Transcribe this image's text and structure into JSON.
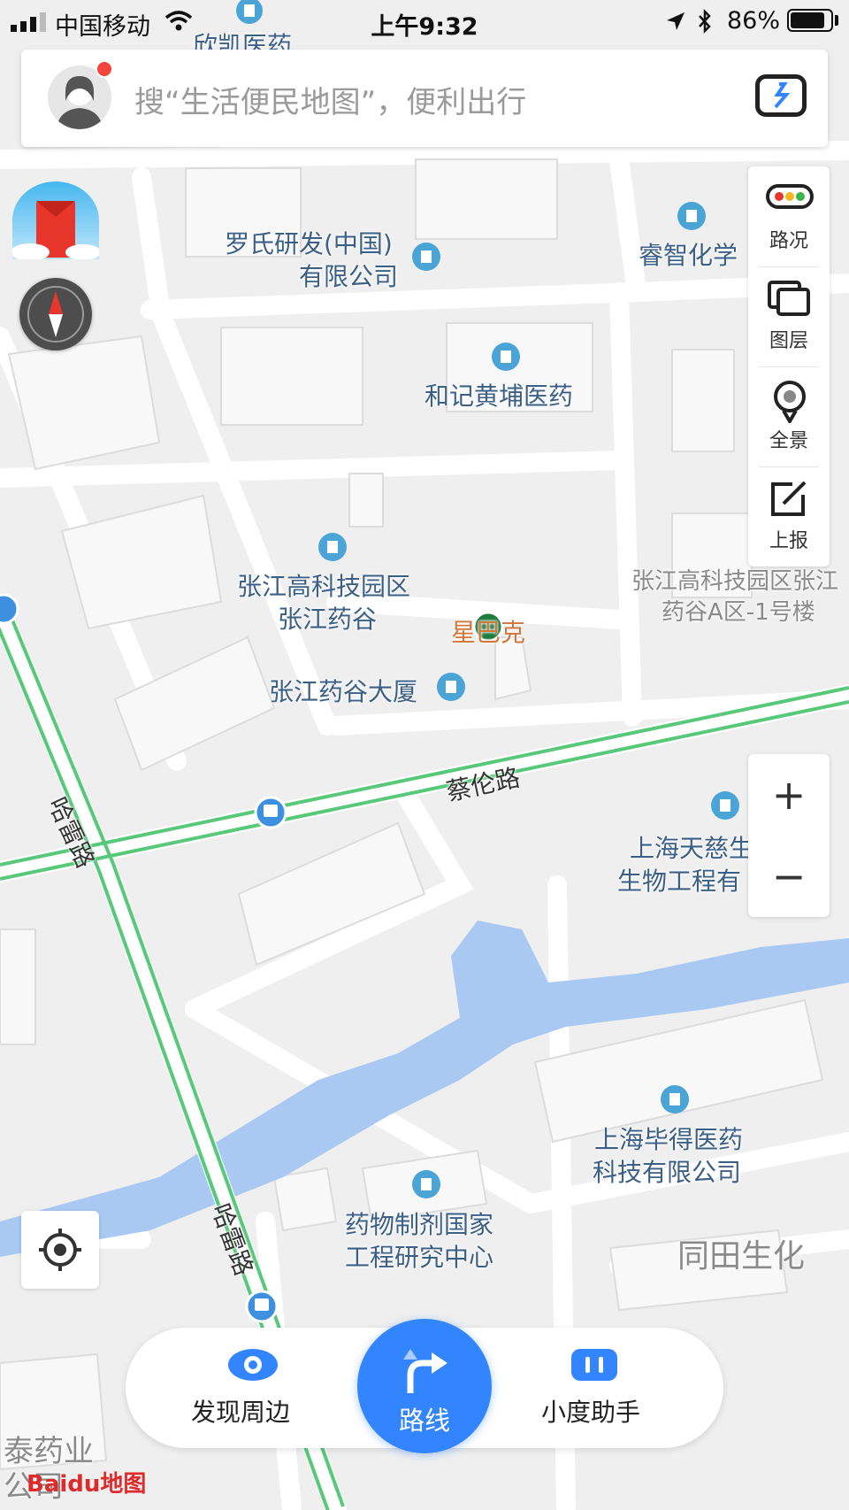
{
  "status_bar": {
    "carrier": "中国移动",
    "time": "上午9:32",
    "battery_percent": "86%",
    "battery_level": 0.86
  },
  "search": {
    "placeholder": "搜“生活便民地图”，便利出行"
  },
  "tools": {
    "traffic": "路况",
    "layers": "图层",
    "panorama": "全景",
    "report": "上报"
  },
  "zoom": {
    "in": "+",
    "out": "−"
  },
  "map_labels": {
    "xinkai": "欣凯医药",
    "roche_1": "罗氏研发(中国)",
    "roche_2": "有限公司",
    "ruizhi": "睿智化学",
    "hutchison": "和记黄埔医药",
    "zj_park_1": "张江高科技园区",
    "zj_park_2": "张江药谷",
    "starbucks": "星巴克",
    "zj_building": "张江药谷大厦",
    "zj_a_1": "张江高科技园区张江",
    "zj_a_2": "药谷A区-1号楼",
    "tianci_1": "上海天慈生",
    "tianci_2": "生物工程有",
    "bide_1": "上海毕得医药",
    "bide_2": "科技有限公司",
    "national_1": "药物制剂国家",
    "national_2": "工程研究中心",
    "tongtian": "同田生化",
    "taiyao_1": "泰药业",
    "taiyao_2": "公司"
  },
  "roads": {
    "cailun": "蔡伦路",
    "halei_top": "哈雷路",
    "halei_bottom": "哈雷路"
  },
  "bottom_nav": {
    "discover": "发现周边",
    "route": "路线",
    "assistant": "小度助手"
  },
  "brand": {
    "logo_text": "Baidu地图"
  },
  "colors": {
    "accent": "#3385ff",
    "road_green": "#58c97a",
    "water": "#a9c9f2"
  }
}
